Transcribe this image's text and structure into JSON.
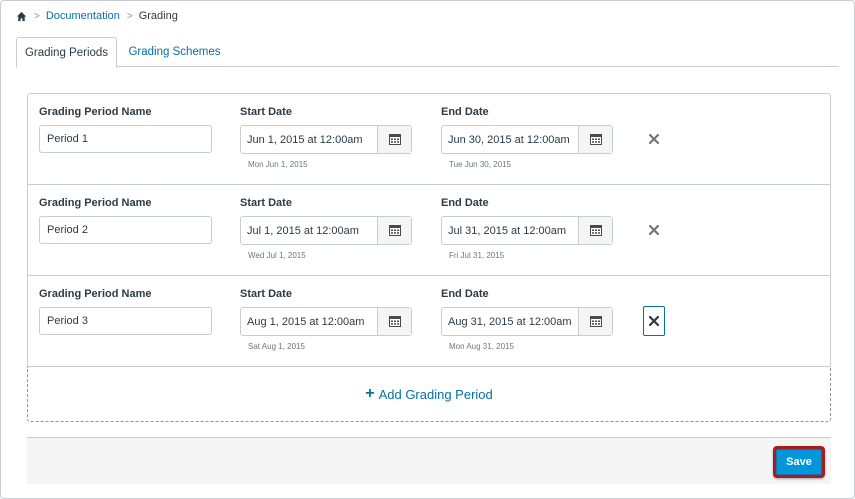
{
  "breadcrumb": {
    "home_icon": "home-icon",
    "items": [
      "Documentation",
      "Grading"
    ]
  },
  "tabs": [
    {
      "label": "Grading Periods",
      "active": true
    },
    {
      "label": "Grading Schemes",
      "active": false
    }
  ],
  "labels": {
    "name": "Grading Period Name",
    "start": "Start Date",
    "end": "End Date"
  },
  "periods": [
    {
      "name": "Period 1",
      "start": "Jun 1, 2015 at 12:00am",
      "start_hint": "Mon Jun 1, 2015",
      "end": "Jun 30, 2015 at 12:00am",
      "end_hint": "Tue Jun 30, 2015"
    },
    {
      "name": "Period 2",
      "start": "Jul 1, 2015 at 12:00am",
      "start_hint": "Wed Jul 1, 2015",
      "end": "Jul 31, 2015 at 12:00am",
      "end_hint": "Fri Jul 31, 2015"
    },
    {
      "name": "Period 3",
      "start": "Aug 1, 2015 at 12:00am",
      "start_hint": "Sat Aug 1, 2015",
      "end": "Aug 31, 2015 at 12:00am",
      "end_hint": "Mon Aug 31, 2015"
    }
  ],
  "add_period": {
    "icon": "+",
    "label": "Add Grading Period"
  },
  "footer": {
    "save_label": "Save"
  },
  "colors": {
    "link": "#0770a3",
    "save": "#0096db",
    "highlight": "#a31d21"
  }
}
